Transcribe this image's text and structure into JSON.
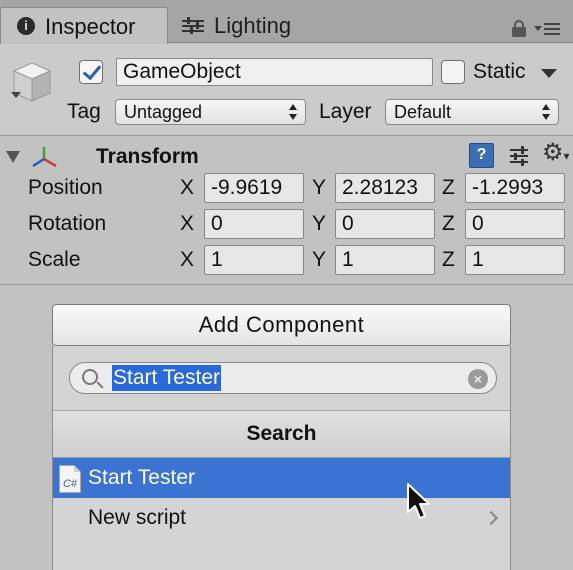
{
  "tabs": {
    "inspector_label": "Inspector",
    "lighting_label": "Lighting"
  },
  "gameobject": {
    "active": true,
    "name": "GameObject",
    "static_label": "Static",
    "static_checked": false,
    "tag_label": "Tag",
    "tag_value": "Untagged",
    "layer_label": "Layer",
    "layer_value": "Default"
  },
  "transform": {
    "title": "Transform",
    "rows": [
      {
        "label": "Position",
        "x": "-9.9619",
        "y": "2.28123",
        "z": "-1.2993"
      },
      {
        "label": "Rotation",
        "x": "0",
        "y": "0",
        "z": "0"
      },
      {
        "label": "Scale",
        "x": "1",
        "y": "1",
        "z": "1"
      }
    ],
    "axis": {
      "x": "X",
      "y": "Y",
      "z": "Z"
    }
  },
  "add_component": {
    "button_label": "Add Component",
    "search_value": "Start Tester",
    "header": "Search",
    "results": [
      {
        "label": "Start Tester",
        "icon": "C#",
        "selected": true
      },
      {
        "label": "New script",
        "selected": false
      }
    ]
  },
  "colors": {
    "selection": "#3a73d1",
    "text_highlight": "#2a6ad8",
    "panel": "#c2c2c2",
    "tab_bar": "#a5a5a5"
  }
}
